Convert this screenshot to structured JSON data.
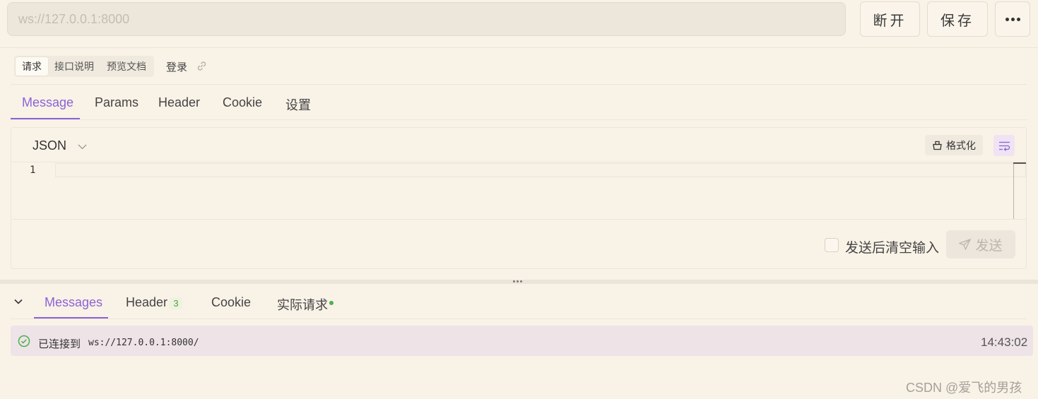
{
  "url_bar": {
    "placeholder": "ws://127.0.0.1:8000"
  },
  "top_buttons": {
    "disconnect": "断开",
    "save": "保存"
  },
  "doc_tabs": [
    {
      "label": "请求",
      "active": true
    },
    {
      "label": "接口说明",
      "active": false
    },
    {
      "label": "预览文档",
      "active": false
    }
  ],
  "login_label": "登录",
  "main_tabs": [
    {
      "label": "Message",
      "active": true
    },
    {
      "label": "Params",
      "active": false
    },
    {
      "label": "Header",
      "active": false
    },
    {
      "label": "Cookie",
      "active": false
    },
    {
      "label": "设置",
      "active": false
    }
  ],
  "editor": {
    "format_select": "JSON",
    "format_button": "格式化",
    "line_numbers": [
      "1"
    ]
  },
  "send_area": {
    "clear_after_send_label": "发送后清空输入",
    "clear_after_send_checked": false,
    "send_button": "发送"
  },
  "result_tabs": [
    {
      "label": "Messages",
      "active": true
    },
    {
      "label": "Header",
      "badge": "3",
      "active": false
    },
    {
      "label": "Cookie",
      "active": false
    },
    {
      "label": "实际请求",
      "active": false
    }
  ],
  "messages": [
    {
      "status": "connected",
      "text": "已连接到",
      "url": "ws://127.0.0.1:8000/",
      "time": "14:43:02"
    }
  ],
  "watermark": "CSDN @爱飞的男孩",
  "colors": {
    "accent": "#8b63d6",
    "success": "#4caf50",
    "background": "#f9f2e7"
  }
}
